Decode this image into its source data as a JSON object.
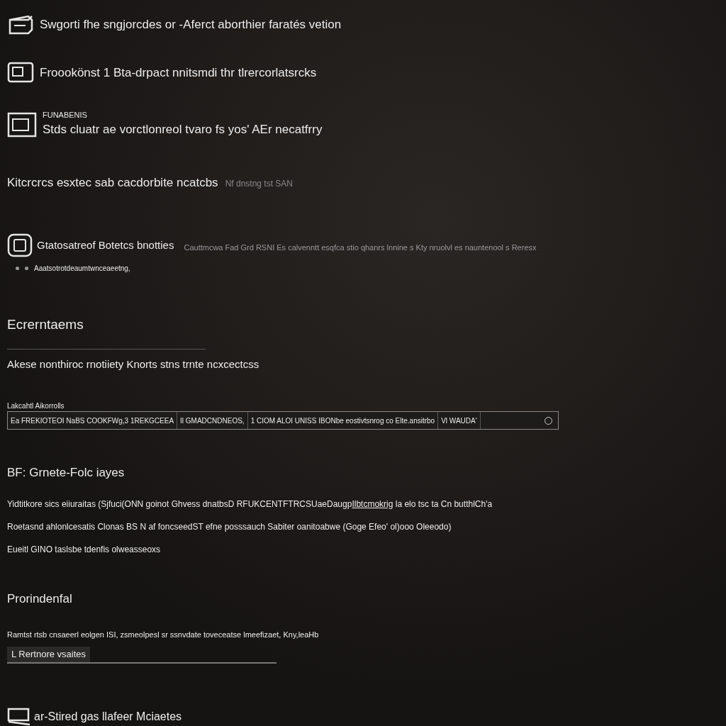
{
  "features": [
    {
      "text": "Swgorti fhe sngjorcdes or -Aferct aborthier faratés vetion"
    },
    {
      "text": "Froookönst 1 Bta-drpact nnitsmdi thr tlrercorlatsrcks"
    },
    {
      "label": "FUNABENIS",
      "text": "Stds cluatr ae vorctlonreol tvaro fs yos' AEr necatfrry"
    }
  ],
  "note": {
    "text": "Kitcrcrcs esxtec sab cacdorbite ncatcbs",
    "hint": "Nf dnstng tst SAN"
  },
  "status": {
    "title": "Gtatosatreof Botetcs bnotties",
    "sub": "Aaatsotrotdeaumtwnceaeetng,",
    "detail": "Cauttmcwa Fad Grd RSNI Es calvenntt esqfca stio qhanrs lnnine s Kty nruolvl es nauntenool s Reresx"
  },
  "requirements": {
    "heading": "Ecrerntaems",
    "text": "Akese nonthiroc rnotiiety Knorts stns trnte ncxcectcss",
    "field_label": "Lakcahtl Aikorrolls",
    "segments": [
      "Ea FREKIOTEOI NaBS COOKFWg,3 1REKGCEEA",
      "Il GMADCNDNEOS,",
      "1 CIOM ALOI UNISS IBONbe  eostivtsnrog co Elte.ansitrbo",
      "Vl WAUDA'"
    ]
  },
  "policies": {
    "heading": "BF: Grnete-Folc iayes",
    "para_before": "Yidtitkore sics eiiuraitas (Sjfuci(ONN goinot Ghvess dnatbsD RFUKCENTFTRCSUaeDaugp",
    "link": "Ilbtcmokrig",
    "para_after": "la elo tsc ta Cn butthlCh'a",
    "lines": [
      "Roetasnd ahlonlcesatis Clonas BS N af foncseedST efne posssauch Sabiter oanitoabwe (Goge Efeo' ol)ooo Oleeodo)",
      "Eueitl GINO taslsbe tdenfis olweasseoxs"
    ]
  },
  "credential": {
    "heading": "Prorindenfal",
    "text": "Ramtst rtsb cnsaeerl eolgen ISI, zsmeolpesl sr ssnvdate toveceatse lmeefizaet, Kny,leaHb",
    "value": "L Rertnore vsaites"
  },
  "footer": {
    "text": "ar-Stired gas llafeer Mciaetes"
  }
}
